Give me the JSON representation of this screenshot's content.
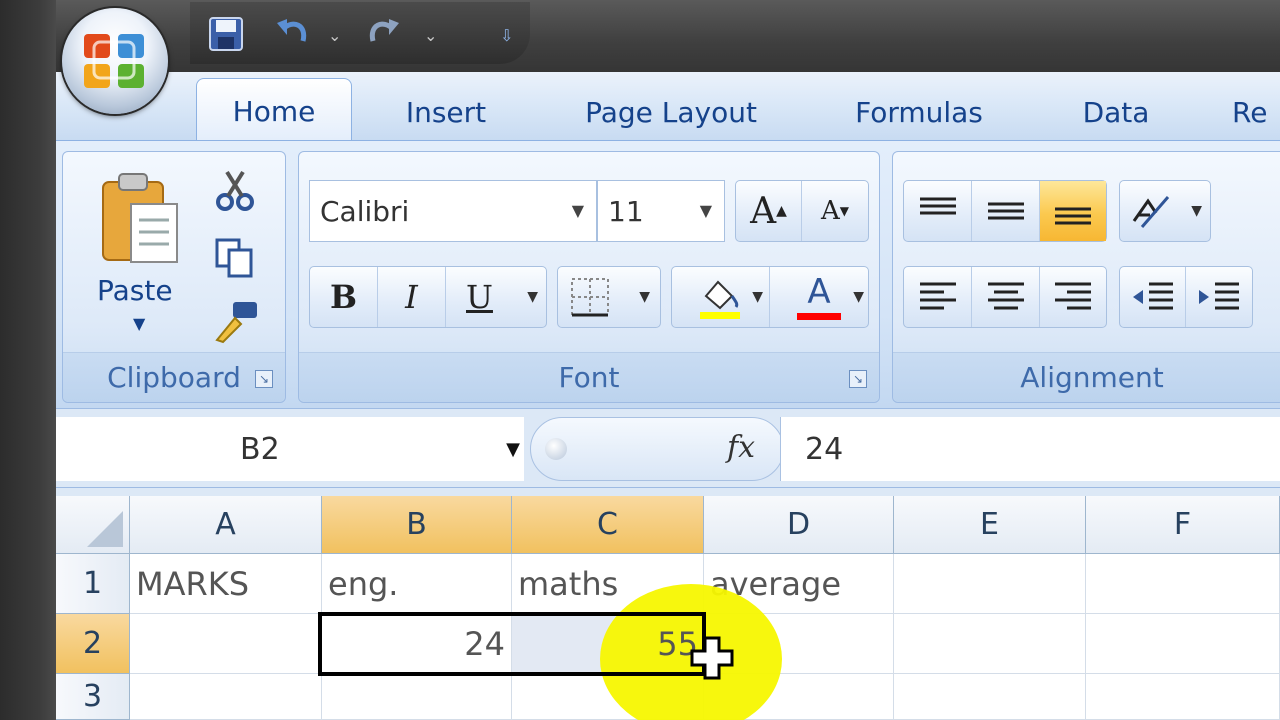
{
  "ribbon": {
    "tabs": [
      {
        "label": "Home"
      },
      {
        "label": "Insert"
      },
      {
        "label": "Page Layout"
      },
      {
        "label": "Formulas"
      },
      {
        "label": "Data"
      },
      {
        "label": "Re"
      }
    ],
    "clipboard": {
      "label": "Clipboard",
      "paste_label": "Paste"
    },
    "font": {
      "label": "Font",
      "font_name": "Calibri",
      "font_size": "11",
      "bold": "B",
      "italic": "I",
      "underline": "U",
      "grow": "A",
      "shrink": "A",
      "color_letter": "A",
      "fill_color": "#ffff00",
      "font_color": "#ff0000"
    },
    "alignment": {
      "label": "Alignment"
    }
  },
  "formula_bar": {
    "name_box": "B2",
    "fx": "fx",
    "value": "24"
  },
  "grid": {
    "columns": [
      "A",
      "B",
      "C",
      "D",
      "E",
      "F"
    ],
    "rows": [
      "1",
      "2",
      "3"
    ],
    "cells": {
      "A1": "MARKS",
      "B1": "eng.",
      "C1": "maths",
      "D1": "average",
      "B2": "24",
      "C2": "55"
    },
    "selection": "B2:C2",
    "header_highlight_color": "#f1c15f",
    "pointer_highlight_color": "#f7f700"
  }
}
